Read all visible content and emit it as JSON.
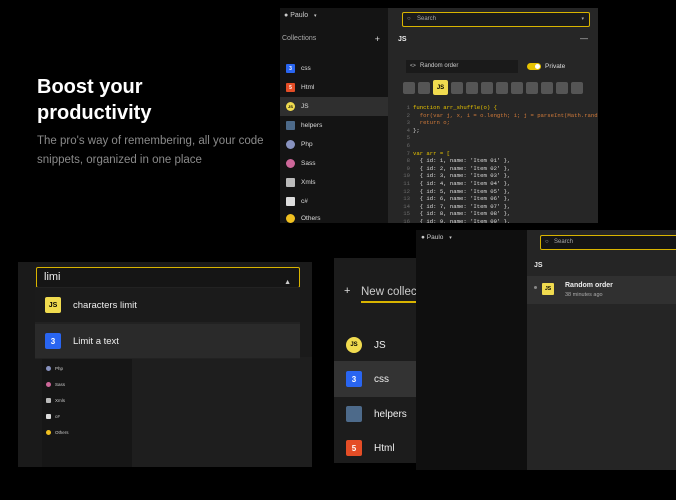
{
  "hero": {
    "title": "Boost your productivity",
    "subtitle": "The pro's way of remembering, all your code snippets, organized in one place"
  },
  "colors": {
    "accent": "#e6c200",
    "js": "#f0db4f",
    "css": "#2965f1",
    "html": "#e44d26",
    "php": "#8892bf",
    "sass": "#cd6799"
  },
  "panel_a": {
    "user": "Paulo",
    "search_placeholder": "Search",
    "collections_label": "Collections",
    "plus": "+",
    "collections": [
      {
        "label": "css",
        "icon": "css-icon"
      },
      {
        "label": "Html",
        "icon": "html-icon"
      },
      {
        "label": "JS",
        "icon": "js-icon"
      },
      {
        "label": "helpers",
        "icon": "helpers-icon"
      },
      {
        "label": "Php",
        "icon": "php-icon"
      },
      {
        "label": "Sass",
        "icon": "sass-icon"
      },
      {
        "label": "Xmls",
        "icon": "xml-icon"
      },
      {
        "label": "c#",
        "icon": "csharp-icon"
      },
      {
        "label": "Others",
        "icon": "others-icon"
      }
    ],
    "header_title": "JS",
    "dash": "—",
    "snippet_title": "Random order",
    "private_label": "Private",
    "code_lines": [
      {
        "n": "1",
        "t": "function arr_shuffle(o) {"
      },
      {
        "n": "2",
        "t": "  for(var j, x, i = o.length; i; j = parseInt(Math.rando"
      },
      {
        "n": "3",
        "t": "  return o;"
      },
      {
        "n": "4",
        "t": "};"
      },
      {
        "n": "5",
        "t": ""
      },
      {
        "n": "6",
        "t": ""
      },
      {
        "n": "7",
        "t": "var arr = ["
      },
      {
        "n": "8",
        "t": "  { id: 1, name: 'Item 01' },"
      },
      {
        "n": "9",
        "t": "  { id: 2, name: 'Item 02' },"
      },
      {
        "n": "10",
        "t": "  { id: 3, name: 'Item 03' },"
      },
      {
        "n": "11",
        "t": "  { id: 4, name: 'Item 04' },"
      },
      {
        "n": "12",
        "t": "  { id: 5, name: 'Item 05' },"
      },
      {
        "n": "13",
        "t": "  { id: 6, name: 'Item 06' },"
      },
      {
        "n": "14",
        "t": "  { id: 7, name: 'Item 07' },"
      },
      {
        "n": "15",
        "t": "  { id: 8, name: 'Item 08' },"
      },
      {
        "n": "16",
        "t": "  { id: 9, name: 'Item 09' },"
      },
      {
        "n": "17",
        "t": "];"
      }
    ]
  },
  "panel_b": {
    "query": "limi",
    "options": [
      {
        "label": "characters limit",
        "icon": "js-icon"
      },
      {
        "label": "Limit a text",
        "icon": "css-icon"
      }
    ],
    "mini_items": [
      "Php",
      "Sass",
      "Xmls",
      "c#",
      "Others"
    ]
  },
  "panel_c": {
    "plus": "+",
    "new_placeholder": "New collection",
    "items": [
      {
        "label": "JS",
        "icon": "js-icon"
      },
      {
        "label": "css",
        "icon": "css-icon"
      },
      {
        "label": "helpers",
        "icon": "helpers-icon"
      },
      {
        "label": "Html",
        "icon": "html-icon"
      }
    ]
  },
  "panel_d": {
    "user": "Paulo",
    "search_placeholder": "Search",
    "header_title": "JS",
    "snippet": {
      "name": "Random order",
      "time": "38 minutes ago"
    }
  }
}
